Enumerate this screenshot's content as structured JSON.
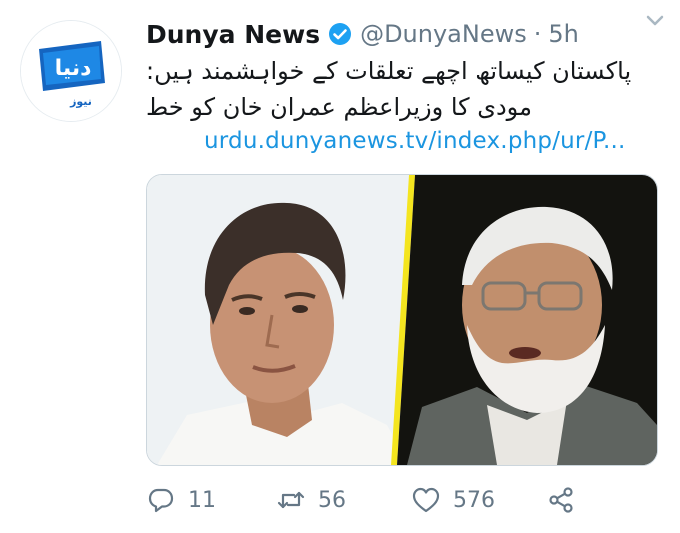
{
  "tweet": {
    "author_name": "Dunya News",
    "handle": "@DunyaNews",
    "separator": "·",
    "time": "5h",
    "text_line1": "پاکستان کیساتھ اچھے تعلقات کے خواہشمند ہیں:",
    "text_line2": "مودی کا وزیراعظم عمران خان کو خط",
    "link": "urdu.dunyanews.tv/index.php/ur/P...",
    "avatar_logo": {
      "wordmark": "دنیا",
      "subtitle": "نیوز"
    }
  },
  "actions": {
    "replies": "11",
    "retweets": "56",
    "likes": "576"
  },
  "colors": {
    "link": "#1b95e0",
    "secondary_text": "#657786",
    "verified": "#1da1f2",
    "logo_blue": "#1565c0",
    "divider": "#f4e51f"
  },
  "icons": [
    "verified-badge-icon",
    "caret-down-icon",
    "reply-icon",
    "retweet-icon",
    "like-icon",
    "share-icon"
  ]
}
